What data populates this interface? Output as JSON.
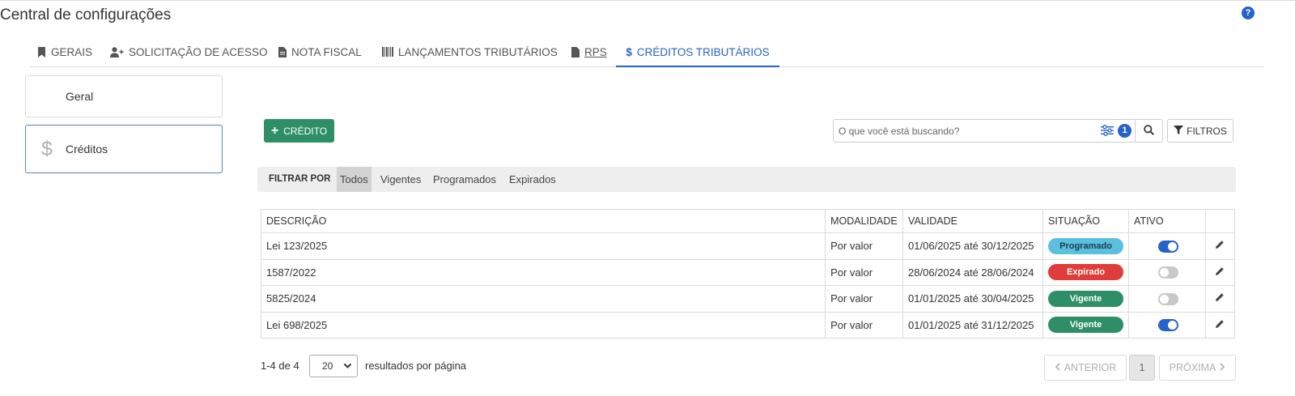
{
  "page": {
    "title": "Central de configurações"
  },
  "tabs": [
    {
      "label": "GERAIS",
      "icon": "bookmark-icon"
    },
    {
      "label": "SOLICITAÇÃO DE ACESSO",
      "icon": "user-plus-icon"
    },
    {
      "label": "NOTA FISCAL",
      "icon": "document-icon"
    },
    {
      "label": "LANÇAMENTOS TRIBUTÁRIOS",
      "icon": "barcode-icon"
    },
    {
      "label": "RPS",
      "icon": "file-icon"
    },
    {
      "label": "CRÉDITOS TRIBUTÁRIOS",
      "icon": "dollar-icon",
      "active": true
    }
  ],
  "sidebar": {
    "items": [
      {
        "label": "Geral"
      },
      {
        "label": "Créditos",
        "active": true,
        "icon": "dollar-icon"
      }
    ]
  },
  "toolbar": {
    "add_label": "CRÉDITO",
    "search_placeholder": "O que você está buscando?",
    "active_filter_count": "1",
    "filters_label": "FILTROS"
  },
  "filter_bar": {
    "label": "FILTRAR POR",
    "options": [
      "Todos",
      "Vigentes",
      "Programados",
      "Expirados"
    ],
    "selected": "Todos"
  },
  "table": {
    "columns": [
      "DESCRIÇÃO",
      "MODALIDADE",
      "VALIDADE",
      "SITUAÇÃO",
      "ATIVO"
    ],
    "rows": [
      {
        "descricao": "Lei 123/2025",
        "modalidade": "Por valor",
        "validade": "01/06/2025 até 30/12/2025",
        "situacao": "Programado",
        "ativo": true
      },
      {
        "descricao": "1587/2022",
        "modalidade": "Por valor",
        "validade": "28/06/2024 até 28/06/2024",
        "situacao": "Expirado",
        "ativo": false
      },
      {
        "descricao": "5825/2024",
        "modalidade": "Por valor",
        "validade": "01/01/2025 até 30/04/2025",
        "situacao": "Vigente",
        "ativo": false
      },
      {
        "descricao": "Lei 698/2025",
        "modalidade": "Por valor",
        "validade": "01/01/2025 até 31/12/2025",
        "situacao": "Vigente",
        "ativo": true
      }
    ]
  },
  "status_colors": {
    "Programado": {
      "bg": "#5bc0de",
      "fg": "#1d3a4a"
    },
    "Expirado": {
      "bg": "#e03c3c",
      "fg": "#ffffff"
    },
    "Vigente": {
      "bg": "#2e8f66",
      "fg": "#ffffff"
    }
  },
  "pagination": {
    "range": "1-4 de 4",
    "per_page": "20",
    "per_page_label": "resultados por página",
    "prev_label": "ANTERIOR",
    "current_page": "1",
    "next_label": "PRÓXIMA"
  },
  "colors": {
    "accent": "#2563c8",
    "success": "#2e8f66"
  }
}
